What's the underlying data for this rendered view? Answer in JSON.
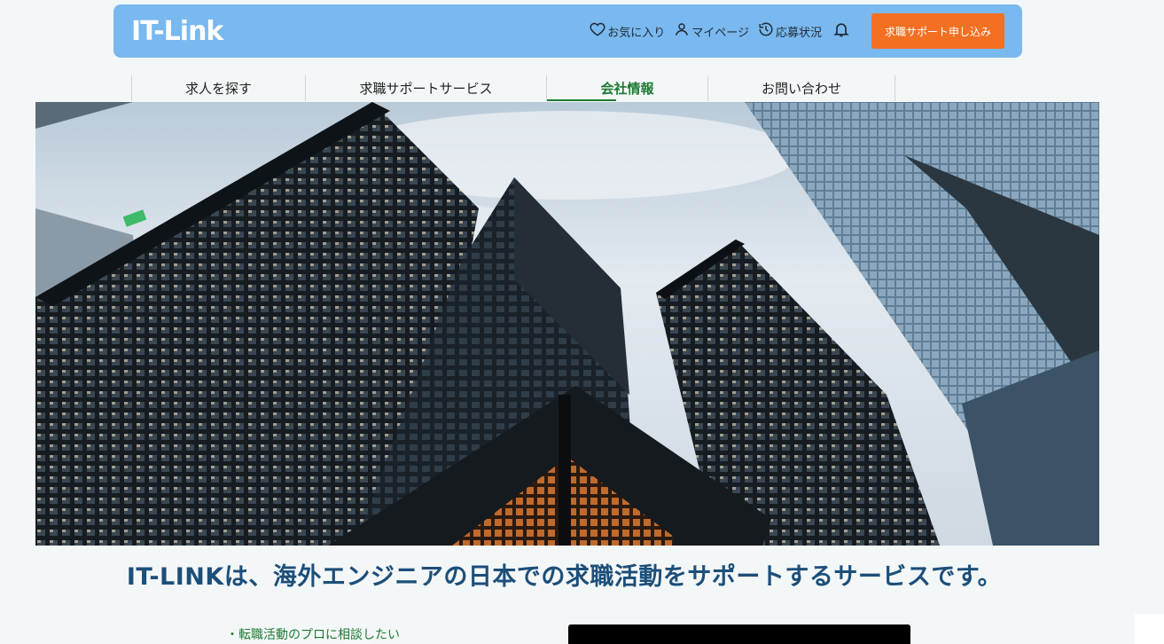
{
  "header": {
    "logo": "IT-Link",
    "actions": [
      {
        "icon": "heart-icon",
        "label": "お気に入り"
      },
      {
        "icon": "user-icon",
        "label": "マイページ"
      },
      {
        "icon": "history-icon",
        "label": "応募状況"
      }
    ],
    "bell_icon": "bell-icon",
    "cta_label": "求職サポート申し込み"
  },
  "nav": {
    "items": [
      {
        "label": "求人を探す",
        "active": false
      },
      {
        "label": "求職サポートサービス",
        "active": false
      },
      {
        "label": "会社情報",
        "active": true
      },
      {
        "label": "お問い合わせ",
        "active": false
      }
    ]
  },
  "hero": {
    "image": "skyscrapers-looking-up"
  },
  "main": {
    "tagline": "IT-LINKは、海外エンジニアの日本での求職活動をサポートするサービスです。",
    "bullets": [
      "・転職活動のプロに相談したい"
    ]
  },
  "colors": {
    "header_bg": "#79b9ef",
    "cta_bg": "#f36f21",
    "accent_green": "#1e7a33",
    "tagline": "#1c4f7a"
  }
}
